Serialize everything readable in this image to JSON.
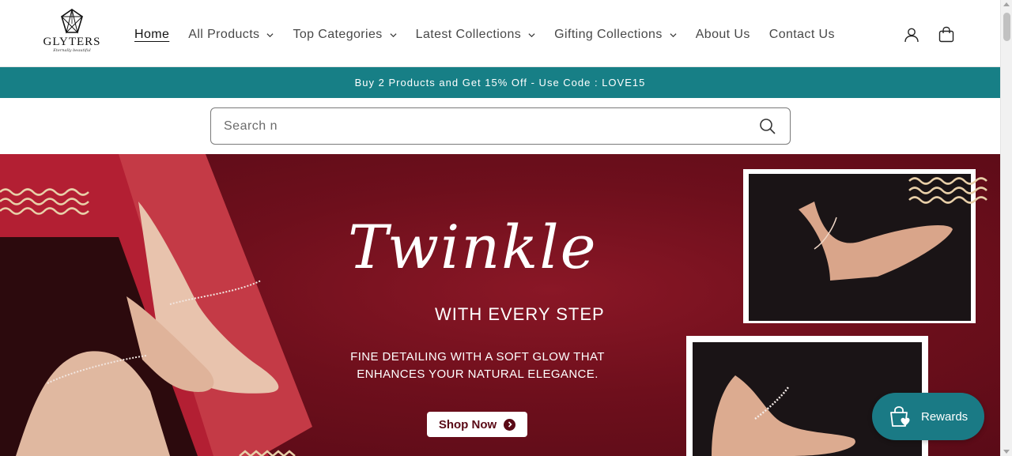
{
  "brand": {
    "name": "GLYTERS",
    "tagline": "Eternally beautiful"
  },
  "nav": {
    "items": [
      {
        "label": "Home",
        "active": true,
        "dropdown": false
      },
      {
        "label": "All Products",
        "active": false,
        "dropdown": true
      },
      {
        "label": "Top Categories",
        "active": false,
        "dropdown": true
      },
      {
        "label": "Latest Collections",
        "active": false,
        "dropdown": true
      },
      {
        "label": "Gifting Collections",
        "active": false,
        "dropdown": true
      },
      {
        "label": "About Us",
        "active": false,
        "dropdown": false
      },
      {
        "label": "Contact Us",
        "active": false,
        "dropdown": false
      }
    ],
    "icons": [
      "account-icon",
      "cart-icon"
    ]
  },
  "announcement": {
    "text": "Buy 2 Products and Get 15% Off - Use Code : LOVE15"
  },
  "search": {
    "value": "",
    "placeholder": "Search n"
  },
  "hero": {
    "title": "Twinkle",
    "subtitle": "WITH EVERY STEP",
    "description": "FINE DETAILING WITH A SOFT GLOW THAT ENHANCES YOUR NATURAL ELEGANCE.",
    "cta_label": "Shop Now"
  },
  "rewards": {
    "label": "Rewards"
  },
  "colors": {
    "accent": "#177f86",
    "hero_bg": "#6e0f1c",
    "text": "#121212"
  }
}
